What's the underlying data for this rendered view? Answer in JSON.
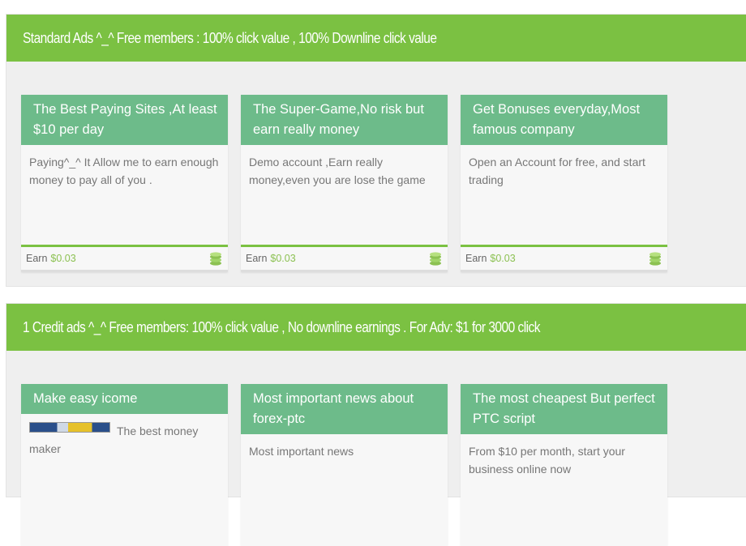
{
  "sections": [
    {
      "title": "Standard Ads ^_^ Free members : 100% click value , 100% Downline click value",
      "cards": [
        {
          "title": "The Best Paying Sites ,At least $10 per day",
          "description": "Paying^_^ It Allow me to earn enough money to pay all of you .",
          "earn_label": "Earn",
          "earn_value": "$0.03"
        },
        {
          "title": "The Super-Game,No risk but earn really money",
          "description": "Demo account ,Earn really money,even you are lose the game",
          "earn_label": "Earn",
          "earn_value": "$0.03"
        },
        {
          "title": "Get Bonuses everyday,Most famous company",
          "description": "Open an Account for free, and start trading",
          "earn_label": "Earn",
          "earn_value": "$0.03"
        }
      ]
    },
    {
      "title": "1 Credit ads ^_^ Free members: 100% click value , No downline earnings . For Adv: $1 for 3000 click",
      "cards": [
        {
          "title": "Make easy icome",
          "description": "The best money maker"
        },
        {
          "title": "Most important news about forex-ptc",
          "description": "Most important news"
        },
        {
          "title": "The most cheapest But perfect PTC script",
          "description": "From $10 per month, start your business online now"
        }
      ]
    }
  ],
  "icons": {
    "coin": "coin-stack-icon"
  },
  "colors": {
    "header_green": "#7bc142",
    "card_title_green": "#6dbb8a",
    "earn_value": "#8cc152"
  }
}
